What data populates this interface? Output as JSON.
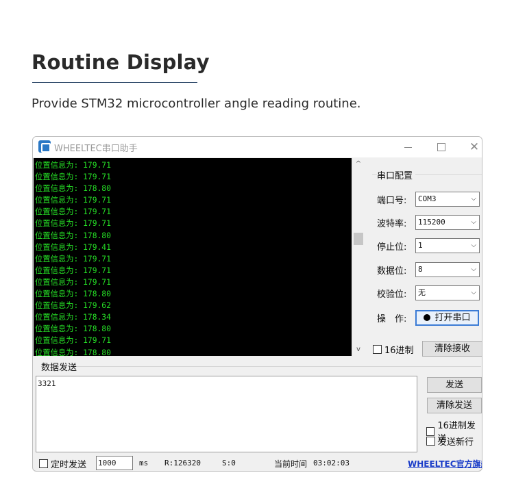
{
  "page": {
    "title": "Routine Display",
    "subtitle": "Provide STM32 microcontroller angle reading routine."
  },
  "window": {
    "title": "WHEELTEC串口助手",
    "close_glyph": "✕"
  },
  "terminal": {
    "lines": [
      "位置信息为: 179.71",
      "位置信息为: 179.71",
      "位置信息为: 178.80",
      "位置信息为: 179.71",
      "位置信息为: 179.71",
      "位置信息为: 179.71",
      "位置信息为: 178.80",
      "位置信息为: 179.41",
      "位置信息为: 179.71",
      "位置信息为: 179.71",
      "位置信息为: 179.71",
      "位置信息为: 178.80",
      "位置信息为: 179.62",
      "位置信息为: 178.34",
      "位置信息为: 178.80",
      "位置信息为: 179.71",
      "位置信息为: 178.80"
    ],
    "scroll_up_glyph": "^",
    "scroll_down_glyph": "v"
  },
  "serial_config": {
    "group_title": "串口配置",
    "port_label": "端口号:",
    "port_value": "COM3",
    "baud_label": "波特率:",
    "baud_value": "115200",
    "stopbits_label": "停止位:",
    "stopbits_value": "1",
    "databits_label": "数据位:",
    "databits_value": "8",
    "parity_label": "校验位:",
    "parity_value": "无",
    "operation_label": "操　作:",
    "open_button_label": "打开串口",
    "hex_receive_label": "16进制",
    "clear_receive_label": "清除接收",
    "chevron_glyph": "⌵"
  },
  "send": {
    "group_title": "数据发送",
    "text_value": "3321",
    "send_button_label": "发送",
    "clear_send_label": "清除发送",
    "hex_send_label": "16进制发送",
    "send_newline_label": "发送新行"
  },
  "status": {
    "timed_send_label": "定时发送",
    "period_value": "1000",
    "period_unit": "ms",
    "rx_count": "R:126320",
    "tx_count": "S:0",
    "time_label": "当前时间",
    "time_value": "03:02:03",
    "store_link": "WHEELTEC官方旗舰店"
  }
}
